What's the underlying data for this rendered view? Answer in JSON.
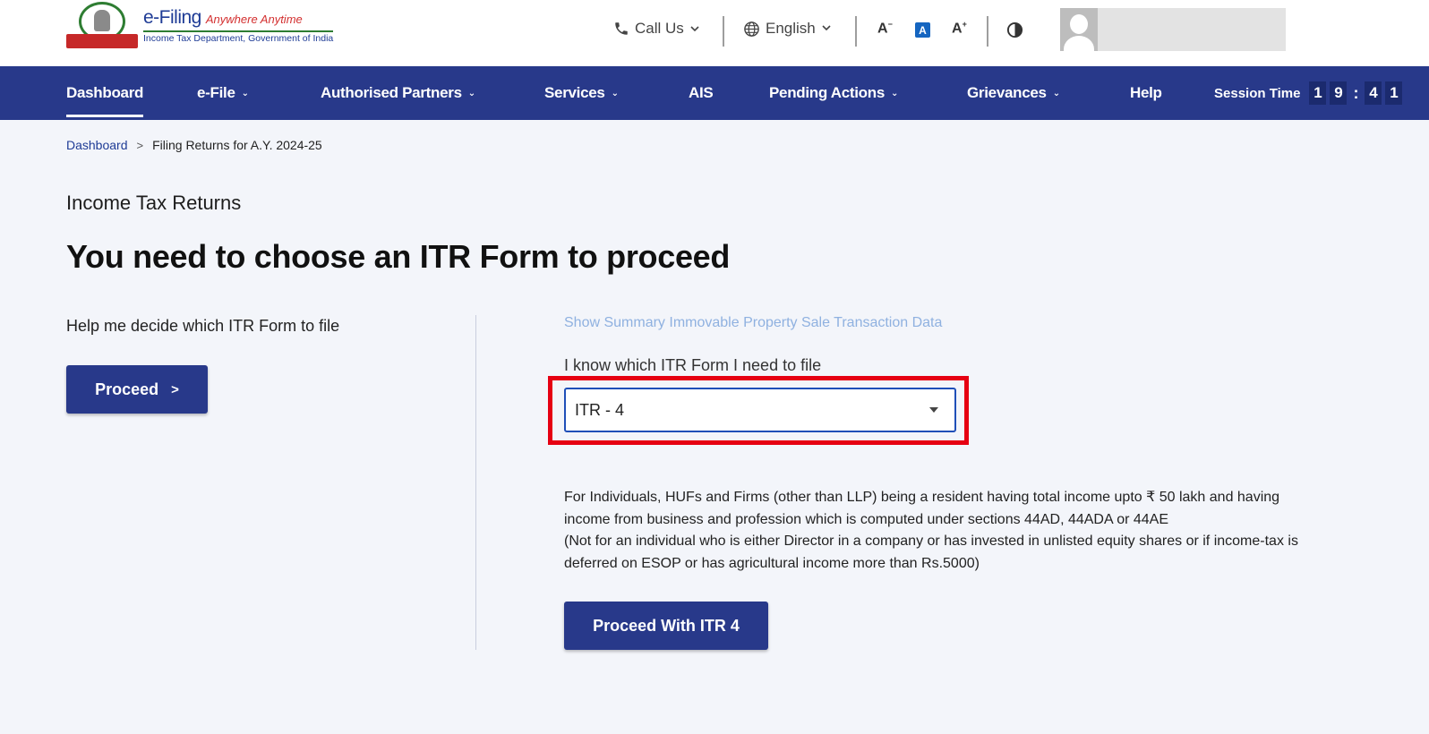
{
  "header": {
    "logo_title": "e-Filing",
    "logo_tagline": "Anywhere Anytime",
    "logo_subtitle": "Income Tax Department, Government of India",
    "call_us": "Call Us",
    "language": "English",
    "font_decrease": "A",
    "font_normal": "A",
    "font_increase": "A",
    "icons": [
      "phone-icon",
      "chevron-down-icon",
      "globe-icon",
      "font-decrease-icon",
      "font-reset-icon",
      "font-increase-icon",
      "contrast-icon",
      "avatar"
    ]
  },
  "nav": {
    "items": [
      {
        "label": "Dashboard",
        "has_dropdown": false,
        "active": true
      },
      {
        "label": "e-File",
        "has_dropdown": true
      },
      {
        "label": "Authorised Partners",
        "has_dropdown": true
      },
      {
        "label": "Services",
        "has_dropdown": true
      },
      {
        "label": "AIS",
        "has_dropdown": false
      },
      {
        "label": "Pending Actions",
        "has_dropdown": true
      },
      {
        "label": "Grievances",
        "has_dropdown": true
      },
      {
        "label": "Help",
        "has_dropdown": false
      }
    ],
    "session_label": "Session Time",
    "session_digits": [
      "1",
      "9",
      "4",
      "1"
    ],
    "session_colon": ":"
  },
  "breadcrumb": {
    "home": "Dashboard",
    "separator": ">",
    "current": "Filing Returns for A.Y. 2024-25"
  },
  "page": {
    "subtitle": "Income Tax Returns",
    "title": "You need to choose an ITR Form to proceed"
  },
  "left": {
    "help_text": "Help me decide which ITR Form to file",
    "proceed_label": "Proceed",
    "proceed_chevron": ">"
  },
  "right": {
    "summary_link": "Show Summary Immovable Property Sale Transaction Data",
    "know_label": "I know which ITR Form I need to file",
    "selected_form": "ITR - 4",
    "description_line1": "For Individuals, HUFs and Firms (other than LLP) being a resident having total income upto ₹ 50 lakh and having income from business and profession which is computed under sections 44AD, 44ADA or 44AE",
    "description_line2": "(Not for an individual who is either Director in a company or has invested in unlisted equity shares or if income-tax is deferred on ESOP or has agricultural income more than Rs.5000)",
    "proceed_itr_label": "Proceed With ITR 4"
  },
  "colors": {
    "primary": "#28398a",
    "highlight": "#e60012",
    "link": "#1f3c96",
    "light_link": "#8fb1e0",
    "background": "#f3f5fa"
  }
}
